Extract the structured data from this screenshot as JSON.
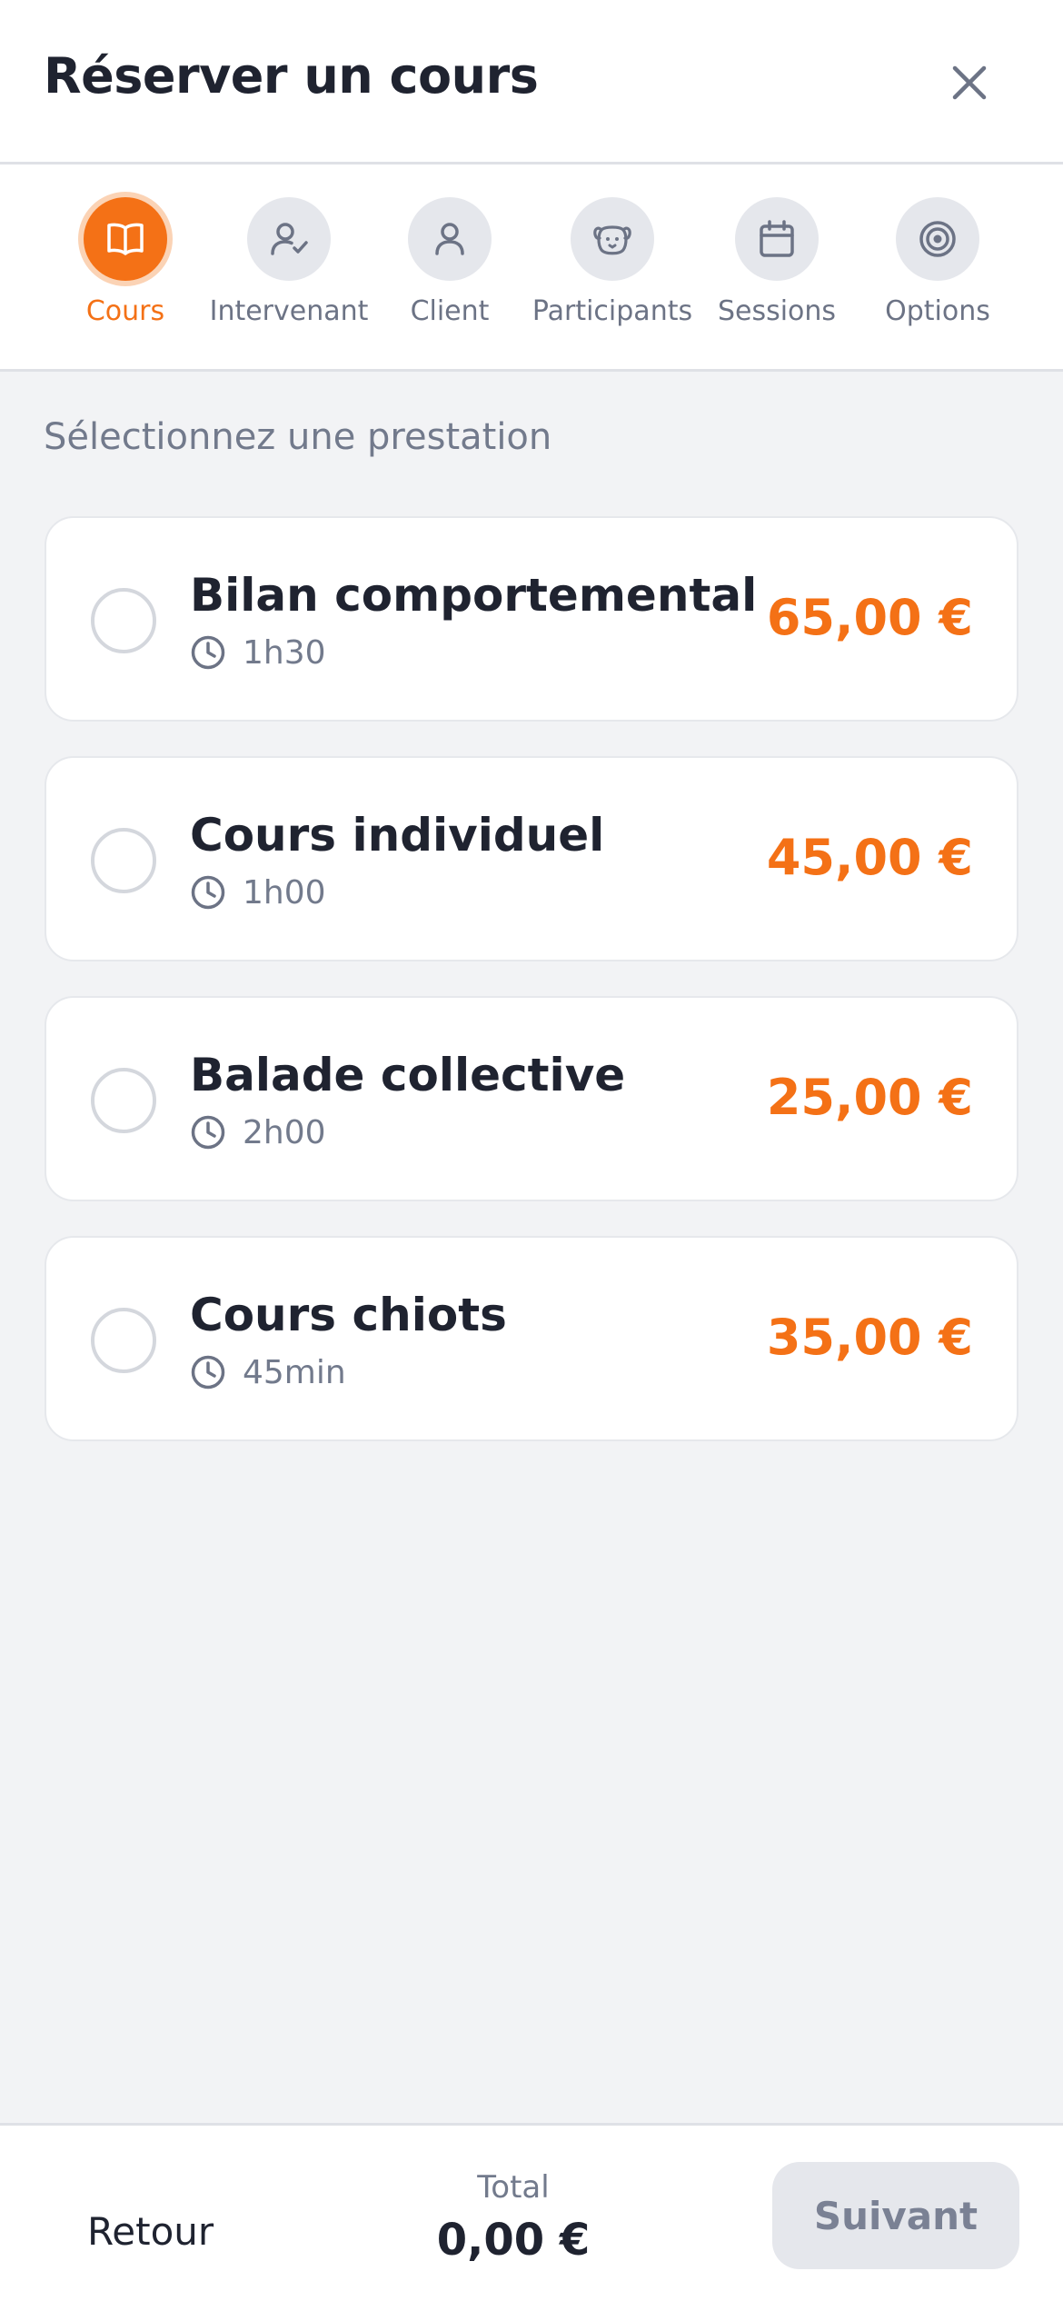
{
  "header": {
    "title": "Réserver un cours",
    "close_icon": "close-icon"
  },
  "stepper": {
    "steps": [
      {
        "label": "Cours",
        "icon": "book-icon",
        "active": true
      },
      {
        "label": "Intervenant",
        "icon": "user-check-icon",
        "active": false
      },
      {
        "label": "Client",
        "icon": "user-icon",
        "active": false
      },
      {
        "label": "Participants",
        "icon": "dog-icon",
        "active": false
      },
      {
        "label": "Sessions",
        "icon": "calendar-icon",
        "active": false
      },
      {
        "label": "Options",
        "icon": "target-icon",
        "active": false
      }
    ]
  },
  "main": {
    "section_title": "Sélectionnez une prestation",
    "services": [
      {
        "name": "Bilan comportemental",
        "duration": "1h30",
        "price": "65,00 €"
      },
      {
        "name": "Cours individuel",
        "duration": "1h00",
        "price": "45,00 €"
      },
      {
        "name": "Balade collective",
        "duration": "2h00",
        "price": "25,00 €"
      },
      {
        "name": "Cours chiots",
        "duration": "45min",
        "price": "35,00 €"
      }
    ]
  },
  "footer": {
    "back_label": "Retour",
    "total_label": "Total",
    "total_value": "0,00 €",
    "next_label": "Suivant"
  },
  "colors": {
    "accent": "#f47116",
    "background": "#f2f3f5",
    "text": "#1f2330",
    "muted": "#727a8c",
    "disabled_button": "#e5e7ec"
  }
}
